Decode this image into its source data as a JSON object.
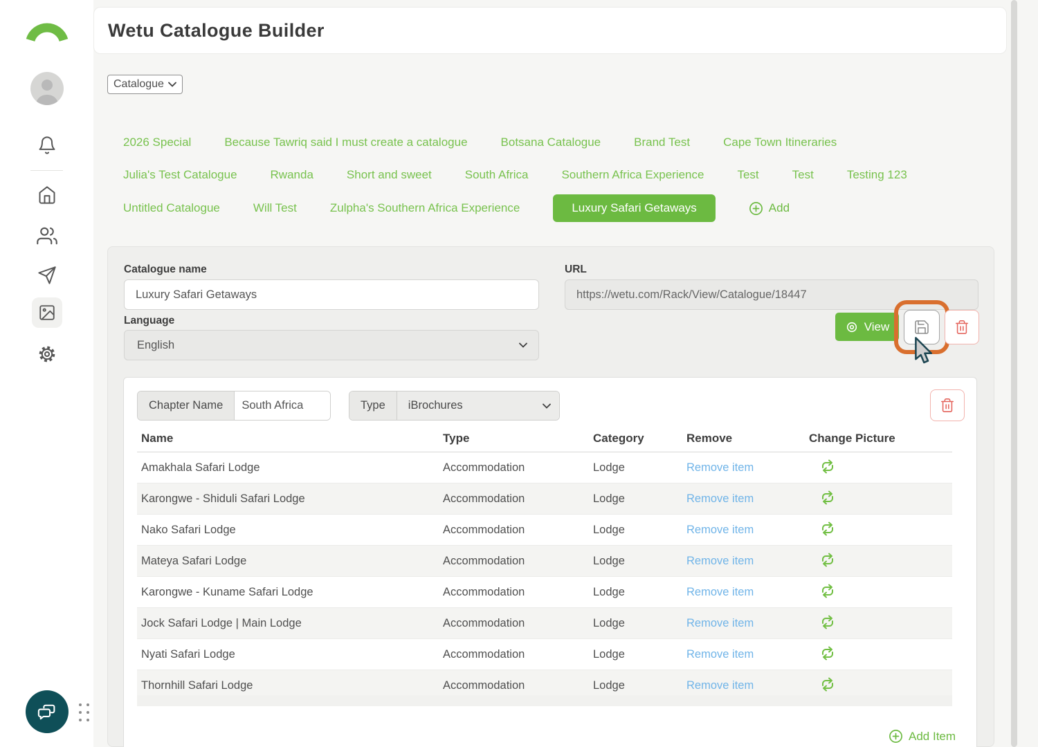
{
  "header": {
    "title": "Wetu Catalogue Builder"
  },
  "view_select": {
    "value": "Catalogue"
  },
  "catalogues": {
    "links": [
      "2026 Special",
      "Because Tawriq said I must create a catalogue",
      "Botsana Catalogue",
      "Brand Test",
      "Cape Town Itineraries",
      "Julia's Test Catalogue",
      "Rwanda",
      "Short and sweet",
      "South Africa",
      "Southern Africa Experience",
      "Test",
      "Test",
      "Testing 123",
      "Untitled Catalogue",
      "Will Test",
      "Zulpha's Southern Africa Experience"
    ],
    "active": "Luxury Safari Getaways",
    "add_label": "Add"
  },
  "form": {
    "catalogue_name_label": "Catalogue name",
    "catalogue_name_value": "Luxury Safari Getaways",
    "url_label": "URL",
    "url_value": "https://wetu.com/Rack/View/Catalogue/18447",
    "language_label": "Language",
    "language_value": "English",
    "view_button_label": "View"
  },
  "chapter": {
    "chapter_name_label": "Chapter Name",
    "chapter_name_value": "South Africa",
    "type_label": "Type",
    "type_value": "iBrochures",
    "add_item_label": "Add Item",
    "table": {
      "headers": [
        "Name",
        "Type",
        "Category",
        "Remove",
        "Change Picture"
      ],
      "remove_item_label": "Remove item",
      "rows": [
        {
          "name": "Amakhala Safari Lodge",
          "type": "Accommodation",
          "category": "Lodge"
        },
        {
          "name": "Karongwe - Shiduli Safari Lodge",
          "type": "Accommodation",
          "category": "Lodge"
        },
        {
          "name": "Nako Safari Lodge",
          "type": "Accommodation",
          "category": "Lodge"
        },
        {
          "name": "Mateya Safari Lodge",
          "type": "Accommodation",
          "category": "Lodge"
        },
        {
          "name": "Karongwe - Kuname Safari Lodge",
          "type": "Accommodation",
          "category": "Lodge"
        },
        {
          "name": "Jock Safari Lodge | Main Lodge",
          "type": "Accommodation",
          "category": "Lodge"
        },
        {
          "name": "Nyati Safari Lodge",
          "type": "Accommodation",
          "category": "Lodge"
        },
        {
          "name": "Thornhill Safari Lodge",
          "type": "Accommodation",
          "category": "Lodge"
        }
      ]
    }
  },
  "icons": {
    "logo": "green-arch",
    "sidebar": [
      "avatar",
      "bell",
      "home",
      "users",
      "send",
      "image",
      "gear",
      "chat"
    ],
    "buttons": [
      "eye",
      "save-floppy",
      "trash",
      "plus-circle",
      "swap-arrows",
      "chevron-down"
    ]
  },
  "colors": {
    "brand_green": "#6cba41",
    "link_green": "#78c24e",
    "remove_blue": "#70b4e8",
    "danger_red": "#e4645c",
    "highlight_orange": "#d96f2e",
    "chat_teal": "#0f4f58"
  }
}
